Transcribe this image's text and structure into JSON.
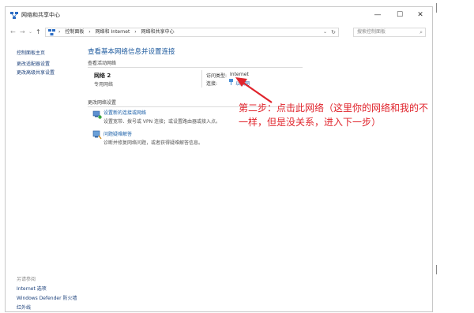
{
  "window": {
    "title": "网络和共享中心",
    "controls": {
      "minimize": "—",
      "maximize": "☐",
      "close": "✕"
    }
  },
  "address_bar": {
    "crumbs": [
      "控制面板",
      "网络和 Internet",
      "网络和共享中心"
    ],
    "separator": "›",
    "search_placeholder": "搜索控制面板"
  },
  "sidebar": {
    "items": [
      {
        "label": "控制面板主页"
      },
      {
        "label": "更改适配器设置"
      },
      {
        "label": "更改高级共享设置"
      }
    ],
    "see_also_heading": "另请参阅",
    "see_also": [
      {
        "label": "Internet 选项"
      },
      {
        "label": "Windows Defender 防火墙"
      },
      {
        "label": "红外线"
      }
    ]
  },
  "main": {
    "title": "查看基本网络信息并设置连接",
    "active_networks_heading": "查看活动网络",
    "network": {
      "name": "网络 2",
      "type": "专用网络",
      "access_type_label": "访问类型:",
      "access_type_value": "Internet",
      "connection_label": "连接:",
      "connection_value": "以太网"
    },
    "change_settings_heading": "更改网络设置",
    "tasks": [
      {
        "icon": "network-setup-icon",
        "link": "设置新的连接或网络",
        "desc": "设置宽带、拨号或 VPN 连接；或设置路由器或接入点。"
      },
      {
        "icon": "troubleshoot-icon",
        "link": "问题疑难解答",
        "desc": "诊断并修复网络问题，或者获得疑难解答信息。"
      }
    ]
  },
  "annotation": {
    "text": "第二步：点击此网络（这里你的网络和我的不一样，但是没关系，进入下一步）",
    "color": "#e0242c"
  }
}
